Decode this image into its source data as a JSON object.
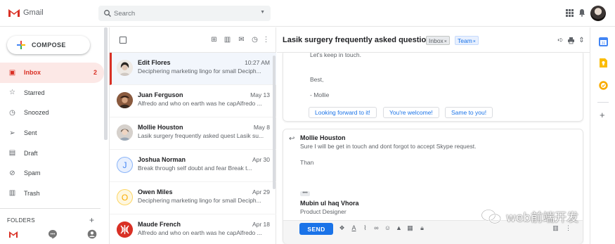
{
  "app": {
    "name": "Gmail"
  },
  "search": {
    "placeholder": "Search"
  },
  "sidebar": {
    "compose_label": "COMPOSE",
    "items": [
      {
        "label": "Inbox",
        "count": "2",
        "icon": "inbox-icon",
        "active": true
      },
      {
        "label": "Starred",
        "count": "",
        "icon": "star-icon"
      },
      {
        "label": "Snoozed",
        "count": "",
        "icon": "clock-icon"
      },
      {
        "label": "Sent",
        "count": "",
        "icon": "send-icon"
      },
      {
        "label": "Draft",
        "count": "",
        "icon": "draft-icon"
      },
      {
        "label": "Spam",
        "count": "",
        "icon": "spam-icon"
      },
      {
        "label": "Trash",
        "count": "",
        "icon": "trash-icon"
      }
    ],
    "folders_label": "FOLDERS",
    "folders_add": "+"
  },
  "list": {
    "rows": [
      {
        "name": "Edit Flores",
        "date": "10:27 AM",
        "snippet": "Deciphering marketing lingo for small Deciph...",
        "selected": true,
        "avatar": {
          "type": "photo",
          "color": "#e8e2dd"
        }
      },
      {
        "name": "Juan Ferguson",
        "date": "May 13",
        "snippet": "Alfredo and who on earth was he capAlfredo ...",
        "avatar": {
          "type": "photo",
          "color": "#7a4a33"
        }
      },
      {
        "name": "Mollie Houston",
        "date": "May 8",
        "snippet": "Lasik surgery frequently asked quest Lasik su...",
        "avatar": {
          "type": "photo",
          "color": "#c9c4bf"
        }
      },
      {
        "name": "Joshua Norman",
        "date": "Apr 30",
        "snippet": "Break through self doubt and fear Break t...",
        "avatar": {
          "type": "letter",
          "letter": "J",
          "bg": "#e8f0fe",
          "fg": "#4285f4",
          "ring": "#8ab4f8"
        }
      },
      {
        "name": "Owen Miles",
        "date": "Apr 29",
        "snippet": "Deciphering marketing lingo for small Deciph...",
        "avatar": {
          "type": "letter",
          "letter": "O",
          "bg": "#fef7e0",
          "fg": "#f9ab00",
          "ring": "#fdd663"
        }
      },
      {
        "name": "Maude French",
        "date": "Apr 18",
        "snippet": "Alfredo and who on earth was he capAlfredo ...",
        "avatar": {
          "type": "pattern",
          "color": "#d93025"
        }
      }
    ]
  },
  "reading": {
    "subject": "Lasik surgery frequently asked questions",
    "labels": [
      "Inbox",
      "Team"
    ],
    "label_close": "×",
    "msg1_lines": [
      "Let's keep in touch.",
      "Best,",
      "- Mollie"
    ],
    "smart_replies": [
      "Looking forward to it!",
      "You're welcome!",
      "Same to you!"
    ],
    "reply": {
      "from": "Mollie Houston",
      "body1": "Sure I will be get in touch and dont forgot to accept Skype request.",
      "body2": "Than",
      "ellipsis": "•••",
      "sig_name": "Mubin ul haq Vhora",
      "sig_title": "Product Designer",
      "send_label": "SEND"
    }
  },
  "watermark": {
    "text": "web前端开发"
  },
  "colors": {
    "accent_red": "#d93025",
    "accent_blue": "#1a73e8",
    "active_bg": "#fce8e6"
  }
}
